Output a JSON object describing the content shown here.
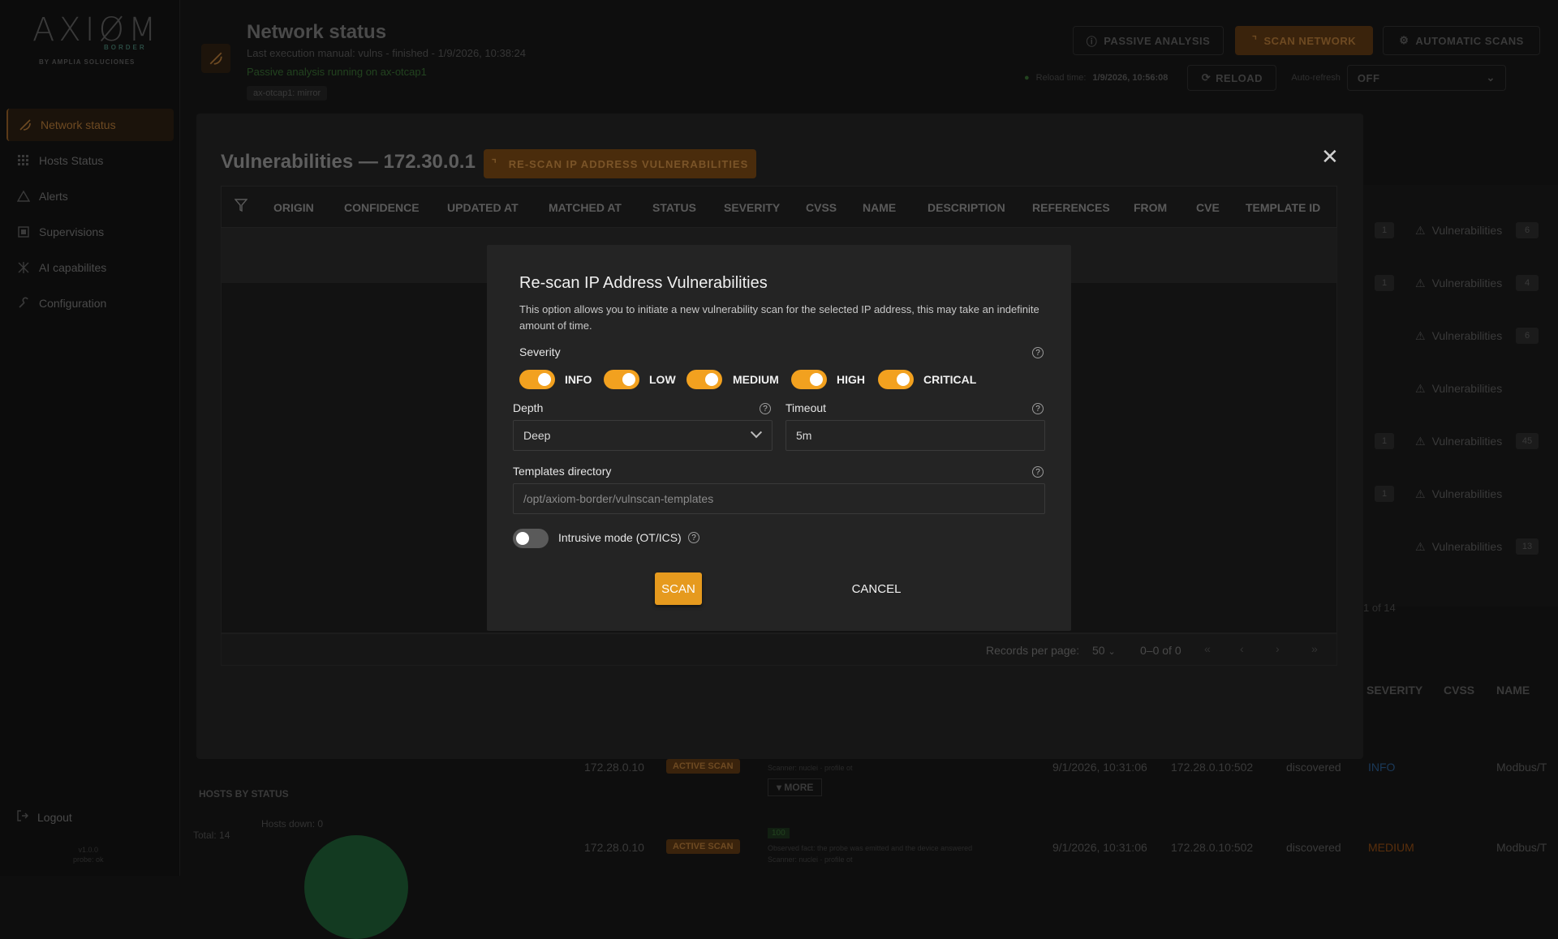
{
  "sidebar": {
    "logo_word": "AXIØM",
    "logo_sub": "BORDER",
    "logo_by": "BY AMPLIA SOLUCIONES",
    "items": [
      {
        "label": "Network status"
      },
      {
        "label": "Hosts Status"
      },
      {
        "label": "Alerts"
      },
      {
        "label": "Supervisions"
      },
      {
        "label": "AI capabilites"
      },
      {
        "label": "Configuration"
      }
    ],
    "logout": "Logout",
    "version_line1": "v1.0.0",
    "version_line2": "probe: ok"
  },
  "header": {
    "title": "Network status",
    "last_execution": "Last execution manual: vulns - finished - 1/9/2026, 10:38:24",
    "passive_status": "Passive analysis running on ax-otcap1",
    "chip": "ax-otcap1: mirror",
    "btn_passive": "PASSIVE ANALYSIS",
    "btn_scan": "SCAN NETWORK",
    "btn_auto": "AUTOMATIC SCANS",
    "reload_time_label": "Reload time:",
    "reload_time": "1/9/2026, 10:56:08",
    "btn_reload": "RELOAD",
    "auto_refresh_label": "Auto-refresh",
    "auto_refresh_value": "OFF"
  },
  "background": {
    "vuln_label": "Vulnerabilities",
    "rows": [
      {
        "c1": "1",
        "c2": "6"
      },
      {
        "c1": "1",
        "c2": "4"
      },
      {
        "c1": "",
        "c2": "6"
      },
      {
        "c1": "",
        "c2": ""
      },
      {
        "c1": "1",
        "c2": "45"
      },
      {
        "c1": "1",
        "c2": ""
      },
      {
        "c1": "",
        "c2": "13"
      }
    ],
    "pager": "1 of 14",
    "th_severity": "SEVERITY",
    "th_cvss": "CVSS",
    "th_name": "NAME",
    "hosts_by_status": "HOSTS BY STATUS",
    "total": "Total: 14",
    "hosts_down": "Hosts down: 0",
    "more": "MORE",
    "bottom_rows": [
      {
        "ip": "172.28.0.10",
        "tag": "ACTIVE SCAN",
        "scanner": "Scanner: nuclei · profile ot",
        "date": "9/1/2026, 10:31:06",
        "addr": "172.28.0.10:502",
        "status": "discovered",
        "severity": "INFO",
        "name": "Modbus/T"
      },
      {
        "ip": "172.28.0.10",
        "tag": "ACTIVE SCAN",
        "scanner": "Observed fact: the probe was emitted and the device answered",
        "date": "9/1/2026, 10:31:06",
        "addr": "172.28.0.10:502",
        "status": "discovered",
        "severity": "MEDIUM",
        "name": "Modbus/T"
      }
    ],
    "score": "100",
    "scanner2": "Scanner: nuclei · profile ot"
  },
  "panel": {
    "title": "Vulnerabilities — 172.30.0.1",
    "rescan_button": "RE-SCAN IP ADDRESS VULNERABILITIES",
    "columns": [
      "ORIGIN",
      "CONFIDENCE",
      "UPDATED AT",
      "MATCHED AT",
      "STATUS",
      "SEVERITY",
      "CVSS",
      "NAME",
      "DESCRIPTION",
      "REFERENCES",
      "FROM",
      "CVE",
      "TEMPLATE ID"
    ],
    "records_label": "Records per page:",
    "records_value": "50",
    "range": "0–0 of 0"
  },
  "modal": {
    "title": "Re-scan IP Address Vulnerabilities",
    "description": "This option allows you to initiate a new vulnerability scan for the selected IP address, this may take an indefinite amount of time.",
    "severity_label": "Severity",
    "severities": [
      "INFO",
      "LOW",
      "MEDIUM",
      "HIGH",
      "CRITICAL"
    ],
    "depth_label": "Depth",
    "depth_value": "Deep",
    "timeout_label": "Timeout",
    "timeout_value": "5m",
    "templates_label": "Templates directory",
    "templates_placeholder": "/opt/axiom-border/vulnscan-templates",
    "intrusive_label": "Intrusive mode (OT/ICS)",
    "help_glyph": "?",
    "scan_button": "SCAN",
    "cancel_button": "CANCEL"
  },
  "colors": {
    "accent": "#f2a11f",
    "accent_dark": "#4a2c0c"
  }
}
